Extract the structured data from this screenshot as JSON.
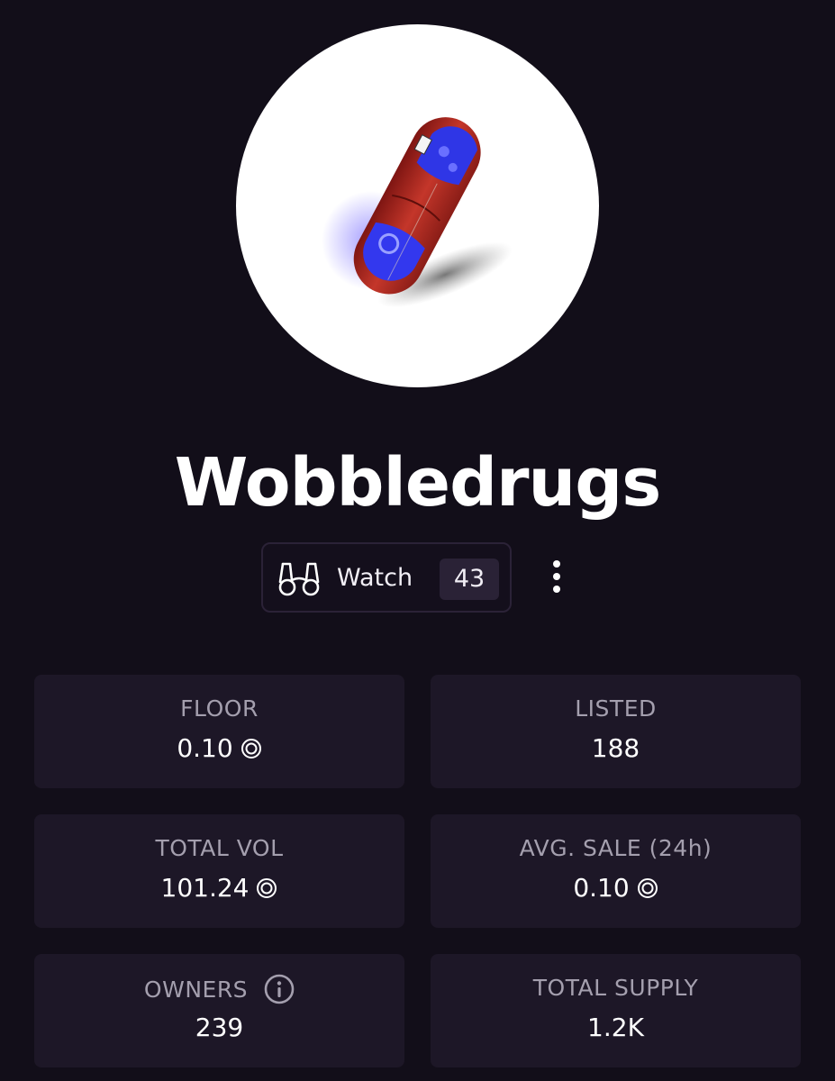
{
  "collection": {
    "name": "Wobbledrugs",
    "avatar_icon": "pill-capsule-image"
  },
  "actions": {
    "watch_label": "Watch",
    "watch_count": "43",
    "watch_icon": "binoculars-icon",
    "more_icon": "more-vertical-icon"
  },
  "stats": {
    "floor": {
      "label": "FLOOR",
      "value": "0.10",
      "currency_icon": "sol-coin-icon"
    },
    "listed": {
      "label": "LISTED",
      "value": "188"
    },
    "total_vol": {
      "label": "TOTAL VOL",
      "value": "101.24",
      "currency_icon": "sol-coin-icon"
    },
    "avg_sale": {
      "label": "AVG. SALE (24h)",
      "value": "0.10",
      "currency_icon": "sol-coin-icon"
    },
    "owners": {
      "label": "OWNERS",
      "value": "239",
      "info_icon": "info-icon"
    },
    "total_supply": {
      "label": "TOTAL SUPPLY",
      "value": "1.2K"
    }
  },
  "colors": {
    "background": "#120e19",
    "card": "#1d1727",
    "label": "#a49fae",
    "text": "#ffffff",
    "pill_red": "#b52a23",
    "pill_blue": "#3a3ef0"
  }
}
